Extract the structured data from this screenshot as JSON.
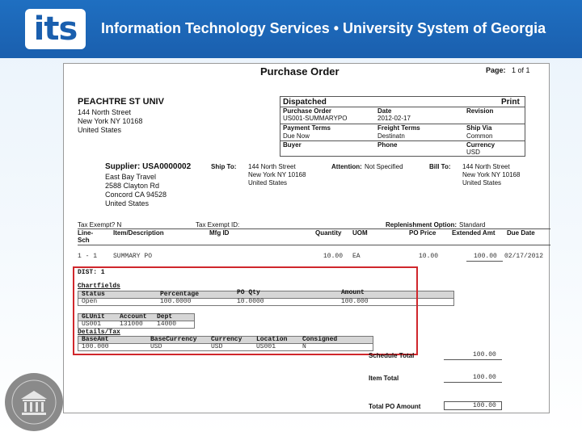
{
  "header": {
    "logo_text": "its",
    "title": "Information Technology Services  •  University System of Georgia",
    "colors": {
      "banner": "#1f6fc1",
      "highlight": "#d0272c"
    }
  },
  "seal": {
    "icon": "university-seal-icon"
  },
  "po": {
    "title": "Purchase Order",
    "page_label": "Page:",
    "page_value": "1 of  1",
    "org": {
      "name": "PEACHTRE ST UNIV",
      "address": [
        "144 North Street",
        "New York NY 10168",
        "United States"
      ]
    },
    "status_box": {
      "status": "Dispatched",
      "print": "Print",
      "po_label": "Purchase Order",
      "po_value": "US001-SUMMARYPO",
      "date_label": "Date",
      "date_value": "2012-02-17",
      "revision_label": "Revision",
      "payment_label": "Payment Terms",
      "payment_value": "Due Now",
      "freight_label": "Freight Terms",
      "freight_value": "Destinatn",
      "shipvia_label": "Ship Via",
      "shipvia_value": "Common",
      "buyer_label": "Buyer",
      "phone_label": "Phone",
      "currency_label": "Currency",
      "currency_value": "USD"
    },
    "supplier": {
      "label": "Supplier: USA0000002",
      "lines": [
        "East Bay Travel",
        "2588 Clayton Rd",
        "Concord CA 94528",
        "United States"
      ]
    },
    "ship_to": {
      "label": "Ship To:",
      "lines": [
        "144 North Street",
        "New York NY 10168",
        "United States"
      ]
    },
    "attention": {
      "label": "Attention:",
      "value": "Not Specified"
    },
    "bill_to": {
      "label": "Bill To:",
      "lines": [
        "144 North Street",
        "New York NY 10168",
        "United States"
      ]
    },
    "tax_exempt": "Tax Exempt? N",
    "tax_exempt_id": "Tax Exempt ID:",
    "replenishment_label": "Replenishment Option:",
    "replenishment_value": "Standard",
    "columns": {
      "line": "Line-",
      "sch": "Sch",
      "item": "Item/Description",
      "mfg": "Mfg ID",
      "qty": "Quantity",
      "uom": "UOM",
      "price": "PO Price",
      "ext": "Extended Amt",
      "due": "Due Date"
    },
    "line_item": {
      "line": "1 - 1",
      "item": "SUMMARY PO",
      "qty": "10.00",
      "uom": "EA",
      "price": "10.00",
      "ext": "100.00",
      "due": "02/17/2012"
    },
    "dist": {
      "label": "DIST: 1",
      "chartfields": "Chartfields",
      "grid1_headers": [
        "Status",
        "Percentage",
        "PO Qty",
        "Amount"
      ],
      "grid1_values": [
        "Open",
        "100.0000",
        "10.0000",
        "100.000"
      ],
      "grid2_headers": [
        "GLUnit",
        "Account",
        "Dept"
      ],
      "grid2_values": [
        "US001",
        "131000",
        "14000"
      ],
      "details_tax": "Details/Tax",
      "grid3_headers": [
        "BaseAmt",
        "BaseCurrency",
        "Currency",
        "Location",
        "Consigned"
      ],
      "grid3_values": [
        "100.000",
        "USD",
        "USD",
        "US001",
        "N"
      ]
    },
    "totals": {
      "schedule_label": "Schedule Total",
      "schedule_value": "100.00",
      "item_label": "Item Total",
      "item_value": "100.00",
      "po_label": "Total PO Amount",
      "po_value": "100.00"
    }
  }
}
